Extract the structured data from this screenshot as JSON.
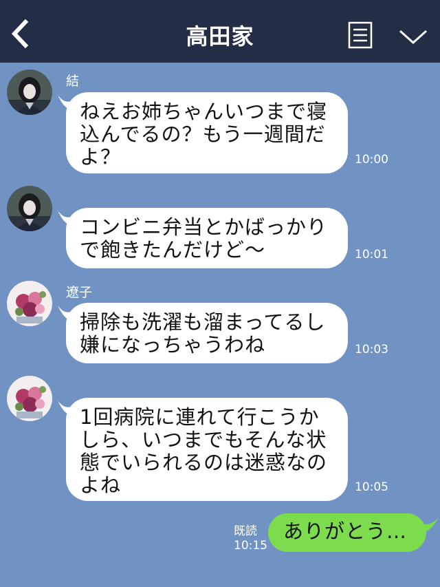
{
  "header": {
    "title": "高田家"
  },
  "messages": [
    {
      "sender": "結",
      "lines": [
        "ねえお姉ちゃんいつまで寝",
        "込んでるの？もう一週間だ",
        "よ？"
      ],
      "time": "10:00"
    },
    {
      "sender": "",
      "lines": [
        "コンビニ弁当とかばっかり",
        "で飽きたんだけど〜"
      ],
      "time": "10:01"
    },
    {
      "sender": "遼子",
      "lines": [
        "掃除も洗濯も溜まってるし",
        "嫌になっちゃうわね"
      ],
      "time": "10:03"
    },
    {
      "sender": "",
      "lines": [
        "1回病院に連れて行こうか",
        "しら、いつまでもそんな状",
        "態でいられるのは迷惑なの",
        "よね"
      ],
      "time": "10:05"
    }
  ],
  "my_message": {
    "text": "ありがとう…",
    "read_label": "既読",
    "time": "10:15"
  },
  "colors": {
    "background": "#7093c4",
    "header": "#232d46",
    "my_bubble": "#7ddc4e",
    "their_bubble": "#ffffff"
  }
}
